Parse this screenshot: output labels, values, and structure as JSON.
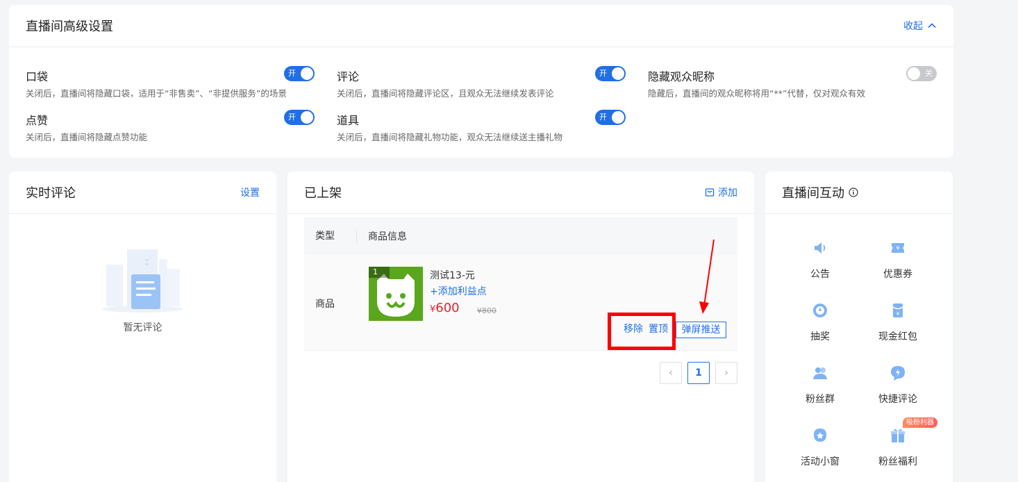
{
  "advanced": {
    "title": "直播间高级设置",
    "collapse_label": "收起",
    "settings": [
      {
        "name": "口袋",
        "desc": "关闭后，直播间将隐藏口袋，适用于“非售卖”、“非提供服务”的场景",
        "toggle": "开",
        "on": true
      },
      {
        "name": "评论",
        "desc": "关闭后，直播间将隐藏评论区，且观众无法继续发表评论",
        "toggle": "开",
        "on": true
      },
      {
        "name": "隐藏观众昵称",
        "desc": "隐藏后，直播间的观众昵称将用“**”代替，仅对观众有效",
        "toggle": "关",
        "on": false
      },
      {
        "name": "点赞",
        "desc": "关闭后，直播间将隐藏点赞功能",
        "toggle": "开",
        "on": true
      },
      {
        "name": "道具",
        "desc": "关闭后，直播间将隐藏礼物功能，观众无法继续送主播礼物",
        "toggle": "开",
        "on": true
      }
    ]
  },
  "comments": {
    "title": "实时评论",
    "settings_label": "设置",
    "empty_text": "暂无评论"
  },
  "listed": {
    "title": "已上架",
    "add_label": "添加",
    "columns": [
      "类型",
      "商品信息"
    ],
    "row": {
      "type": "商品",
      "index": "1",
      "name": "测试13-元",
      "add_benefit": "+添加利益点",
      "currency": "¥",
      "price": "600",
      "original_price": "¥800",
      "actions": {
        "remove": "移除",
        "top": "置顶",
        "push": "弹屏推送"
      }
    },
    "pagination": {
      "current": "1",
      "prev": "‹",
      "next": "›"
    }
  },
  "interaction": {
    "title": "直播间互动",
    "items": [
      {
        "label": "公告",
        "icon": "speaker-icon"
      },
      {
        "label": "优惠券",
        "icon": "coupon-icon"
      },
      {
        "label": "抽奖",
        "icon": "lottery-icon"
      },
      {
        "label": "现金红包",
        "icon": "red-packet-icon"
      },
      {
        "label": "粉丝群",
        "icon": "fan-group-icon"
      },
      {
        "label": "快捷评论",
        "icon": "quick-comment-icon"
      },
      {
        "label": "活动小窗",
        "icon": "activity-window-icon"
      },
      {
        "label": "粉丝福利",
        "icon": "gift-icon"
      }
    ],
    "hot_tag": "吸粉利器"
  },
  "colors": {
    "accent": "#1f6fe5",
    "price": "#e8222b",
    "highlight": "#ff0000",
    "icon": "#7fb2f5"
  }
}
